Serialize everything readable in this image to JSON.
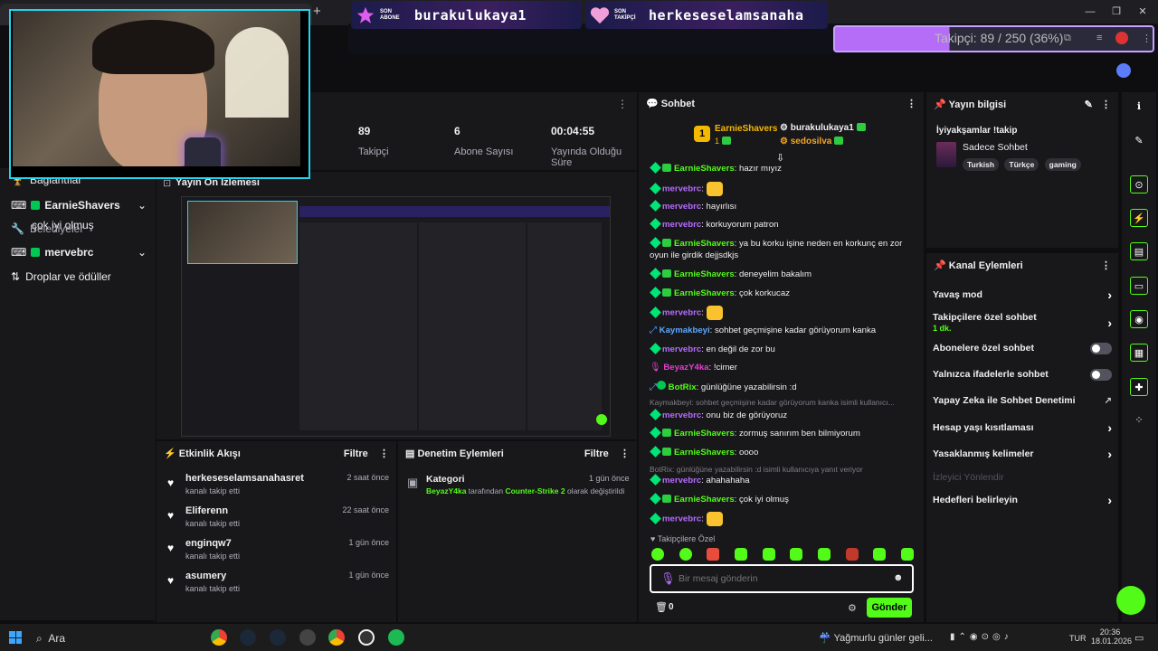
{
  "overlay": {
    "last_sub_label_1": "SON",
    "last_sub_label_2": "ABONE",
    "last_sub_name": "burakulukaya1",
    "last_follow_label_1": "SON",
    "last_follow_label_2": "TAKİPÇİ",
    "last_follow_name": "herkeseselamsanaha",
    "goal_text": "Takipçi: 89 / 250 (36%)",
    "goal_fraction": 0.36
  },
  "left": {
    "item1": "Bağlantılar",
    "user1": "EarnieShavers",
    "msg1": "çok iyi olmuş",
    "item2": "Belediyeler",
    "user2": "mervebrc",
    "item3": "Droplar ve ödüller"
  },
  "stats": [
    {
      "value": "89",
      "label": "Takipçi"
    },
    {
      "value": "6",
      "label": "Abone Sayısı"
    },
    {
      "value": "00:04:55",
      "label": "Yayında Olduğu Süre"
    }
  ],
  "preview": {
    "title": "Yayın Ön İzlemesi"
  },
  "feed": {
    "title": "Etkinlik Akışı",
    "filter": "Filtre",
    "items": [
      {
        "name": "herkeseselamsanahasret",
        "sub": "kanalı takip etti",
        "time": "2 saat önce"
      },
      {
        "name": "Eliferenn",
        "sub": "kanalı takip etti",
        "time": "22 saat önce"
      },
      {
        "name": "enginqw7",
        "sub": "kanalı takip etti",
        "time": "1 gün önce"
      },
      {
        "name": "asumery",
        "sub": "kanalı takip etti",
        "time": "1 gün önce"
      }
    ]
  },
  "mod": {
    "title": "Denetim Eylemleri",
    "filter": "Filtre",
    "item_title": "Kategori",
    "item_time": "1 gün önce",
    "item_user": "BeyazY4ka",
    "item_mid": "tarafından",
    "item_game": "Counter-Strike 2",
    "item_end": "olarak değiştirildi"
  },
  "chat": {
    "title": "Sohbet",
    "top1_rank": "1",
    "top1_name": "EarnieShavers",
    "top1_count": "1",
    "top2_name": "burakulukaya1",
    "top3_name": "sedosilva",
    "messages": [
      {
        "user": "EarnieShavers",
        "text": ": hazır mıyız",
        "color": "#53fc18"
      },
      {
        "user": "mervebrc",
        "text": ": ",
        "color": "#b66cff"
      },
      {
        "user": "mervebrc",
        "text": ": hayırlısı",
        "color": "#b66cff"
      },
      {
        "user": "mervebrc",
        "text": ": korkuyorum patron",
        "color": "#b66cff"
      },
      {
        "user": "EarnieShavers",
        "text": ": ya bu korku işine neden en korkunç en zor oyun ile girdik dejjsdkjs",
        "color": "#53fc18"
      },
      {
        "user": "EarnieShavers",
        "text": ": deneyelim bakalım",
        "color": "#53fc18"
      },
      {
        "user": "EarnieShavers",
        "text": ": çok korkucaz",
        "color": "#53fc18"
      },
      {
        "user": "mervebrc",
        "text": ": ",
        "color": "#b66cff"
      },
      {
        "user": "Kaymakbeyi",
        "text": ": sohbet geçmişine kadar görüyorum kanka",
        "color": "#5aa9ff"
      },
      {
        "user": "mervebrc",
        "text": ": en değil de zor bu",
        "color": "#b66cff"
      },
      {
        "user": "BeyazY4ka",
        "text": ": !cimer",
        "color": "#e23fd0"
      },
      {
        "user": "BotRix",
        "text": ": günlüğüne yazabilirsin :d",
        "color": "#53fc18"
      }
    ],
    "reply1": "Kaymakbeyi: sohbet geçmişine kadar görüyorum kanka isimli kullanıcı...",
    "messages2": [
      {
        "user": "mervebrc",
        "text": ": onu biz de görüyoruz",
        "color": "#b66cff"
      },
      {
        "user": "EarnieShavers",
        "text": ": zormuş sanırım ben bilmiyorum",
        "color": "#53fc18"
      },
      {
        "user": "EarnieShavers",
        "text": ": oooo",
        "color": "#53fc18"
      }
    ],
    "reply2": "BotRix: günlüğüne yazabilirsin :d isimli kullanıcıya yanıt veriyor",
    "messages3": [
      {
        "user": "mervebrc",
        "text": ": ahahahaha",
        "color": "#b66cff"
      },
      {
        "user": "EarnieShavers",
        "text": ": çok iyi olmuş",
        "color": "#53fc18"
      },
      {
        "user": "mervebrc",
        "text": ": ",
        "color": "#b66cff"
      }
    ],
    "emote_label": "Takipçilere Özel",
    "placeholder": "Bir mesaj gönderin",
    "points": "0",
    "send": "Gönder"
  },
  "info": {
    "title": "Yayın bilgisi",
    "stream_title": "İyiyakşamlar !takip",
    "category": "Sadece Sohbet",
    "tags": [
      "Turkish",
      "Türkçe",
      "gaming"
    ]
  },
  "kanal": {
    "title": "Kanal Eylemleri",
    "rows": [
      {
        "label": "Yavaş mod",
        "type": "chevron"
      },
      {
        "label": "Takipçilere özel sohbet",
        "sub": "1 dk.",
        "type": "chevron"
      },
      {
        "label": "Abonelere özel sohbet",
        "type": "toggle"
      },
      {
        "label": "Yalnızca ifadelerle sohbet",
        "type": "toggle"
      },
      {
        "label": "Yapay Zeka ile Sohbet Denetimi",
        "type": "external"
      },
      {
        "label": "Hesap yaşı kısıtlaması",
        "type": "chevron"
      },
      {
        "label": "Yasaklanmış kelimeler",
        "type": "chevron"
      },
      {
        "label": "İzleyici Yönlendir",
        "type": "disabled"
      },
      {
        "label": "Hedefleri belirleyin",
        "type": "chevron"
      }
    ]
  },
  "taskbar": {
    "search": "Ara",
    "weather": "Yağmurlu günler geli...",
    "lang": "TUR",
    "time": "20:36",
    "date": "18.01.2026"
  },
  "colors": {
    "accent": "#53fc18",
    "goal": "#b56cf7",
    "webcam_border": "#22d3ee"
  }
}
